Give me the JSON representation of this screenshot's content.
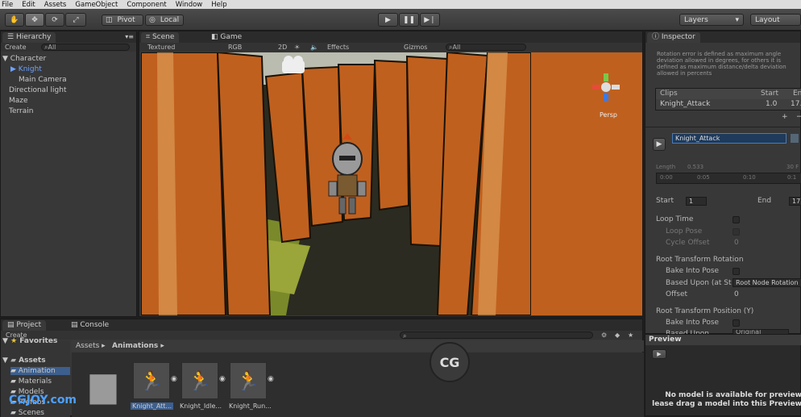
{
  "menu": [
    "File",
    "Edit",
    "Assets",
    "GameObject",
    "Component",
    "Window",
    "Help"
  ],
  "toolbar": {
    "pivot": "Pivot",
    "local": "Local",
    "layers": "Layers",
    "layout": "Layout",
    "tools": [
      "hand-icon",
      "move-icon",
      "rotate-icon",
      "scale-icon"
    ]
  },
  "hierarchy": {
    "tab": "Hierarchy",
    "create": "Create",
    "search": "All",
    "items": [
      {
        "label": "Character",
        "indent": 0,
        "selected": false
      },
      {
        "label": "Knight",
        "indent": 1,
        "selected": true
      },
      {
        "label": "Main Camera",
        "indent": 1,
        "selected": false
      },
      {
        "label": "Directional light",
        "indent": 0,
        "selected": false
      },
      {
        "label": "Maze",
        "indent": 0,
        "selected": false
      },
      {
        "label": "Terrain",
        "indent": 0,
        "selected": false
      }
    ]
  },
  "scene": {
    "tab_scene": "Scene",
    "tab_game": "Game",
    "shading": "Textured",
    "color": "RGB",
    "mode2d": "2D",
    "effects": "Effects",
    "gizmos": "Gizmos",
    "search": "All",
    "persp": "Persp"
  },
  "inspector": {
    "tab": "Inspector",
    "note": "Rotation error is defined as maximum angle deviation allowed in degrees, for others it is defined as maximum distance/delta deviation allowed in percents",
    "clips_header": "Clips",
    "start_header": "Start",
    "end_header": "En",
    "clip_name": "Knight_Attack",
    "clip_start": "1.0",
    "clip_end": "17.",
    "plus": "+",
    "minus": "−",
    "clip_field": "Knight_Attack",
    "length_label": "Length",
    "length_value": "0.533",
    "fps": "30 F",
    "timeline_ticks": [
      "0:00",
      "0:05",
      "0:10",
      "0:1"
    ],
    "start_label": "Start",
    "start_value": "1",
    "end_label": "End",
    "end_value": "17",
    "loop_time": "Loop Time",
    "loop_pose": "Loop Pose",
    "cycle_offset": "Cycle Offset",
    "cycle_value": "0",
    "rt_rotation": "Root Transform Rotation",
    "bake_pose": "Bake Into Pose",
    "based_upon": "Based Upon (at St",
    "based_value": "Root Node Rotation",
    "offset": "Offset",
    "offset_value": "0",
    "rt_position": "Root Transform Position (Y)",
    "bake_pose2": "Bake Into Pose",
    "based_upon2": "Based Upon",
    "based_value2": "Original"
  },
  "preview": {
    "title": "Preview",
    "line1": "No model is available for preview",
    "line2": "lease drag a model into this Preview"
  },
  "project": {
    "tab_project": "Project",
    "tab_console": "Console",
    "create": "Create",
    "favorites": "Favorites",
    "assets_root": "Assets",
    "tree": [
      "Animation",
      "Materials",
      "Models",
      "Prefabs",
      "Scenes"
    ],
    "breadcrumb_root": "Assets",
    "breadcrumb_current": "Animations",
    "assets": [
      "",
      "Knight_Att...",
      "Knight_Idle...",
      "Knight_Run..."
    ]
  },
  "watermark": "CGJOY.com",
  "colors": {
    "accent": "#6ea2ff",
    "wall": "#c0601e"
  }
}
